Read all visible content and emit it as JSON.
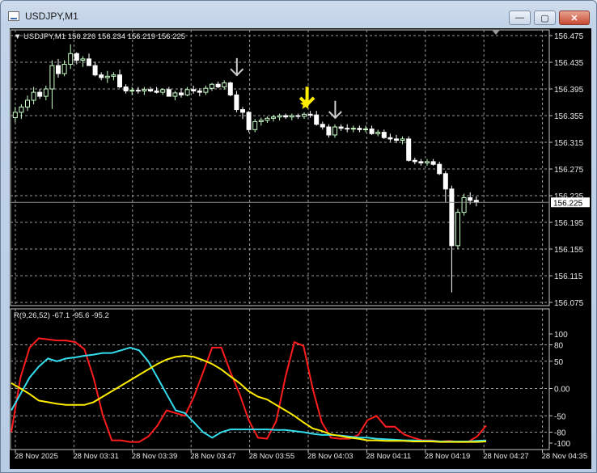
{
  "window": {
    "title": "USDJPY,M1",
    "buttons": {
      "minimize": "—",
      "maximize": "▢",
      "close": "✕"
    }
  },
  "main_panel": {
    "info": "▼ USDJPY,M1  156.226 156.234 156.219 156.225",
    "price_ticks": [
      "156.475",
      "156.435",
      "156.395",
      "156.355",
      "156.315",
      "156.275",
      "156.235",
      "156.195",
      "156.155",
      "156.115",
      "156.075"
    ],
    "current_price": "156.225"
  },
  "indicator_panel": {
    "info": "R(9,26,52) -67.1 -95.6 -95.2",
    "ticks": [
      "100",
      "80",
      "50",
      "0.00",
      "-50",
      "-80",
      "-100"
    ]
  },
  "time_axis": [
    "28 Nov 2025",
    "28 Nov 03:31",
    "28 Nov 03:39",
    "28 Nov 03:47",
    "28 Nov 03:55",
    "28 Nov 04:03",
    "28 Nov 04:11",
    "28 Nov 04:19",
    "28 Nov 04:27",
    "28 Nov 04:35"
  ],
  "colors": {
    "background": "#000000",
    "grid": "#9a9a9a",
    "bull": "#c8ffc8",
    "bear": "#ffffff",
    "line_red": "#ff1c1c",
    "line_cyan": "#33ddee",
    "line_yellow": "#ffee00",
    "arrow_gray": "#cfcfcf",
    "arrow_yellow": "#ffee00"
  },
  "chart_data": [
    {
      "type": "candlestick",
      "symbol": "USDJPY",
      "timeframe": "M1",
      "ylim": [
        156.075,
        156.475
      ],
      "candles": [
        [
          156.352,
          156.368,
          156.345,
          156.36
        ],
        [
          156.36,
          156.372,
          156.35,
          156.368
        ],
        [
          156.368,
          156.385,
          156.362,
          156.378
        ],
        [
          156.378,
          156.398,
          156.372,
          156.39
        ],
        [
          156.39,
          156.395,
          156.38,
          156.384
        ],
        [
          156.384,
          156.4,
          156.378,
          156.395
        ],
        [
          156.395,
          156.438,
          156.365,
          156.43
        ],
        [
          156.43,
          156.44,
          156.412,
          156.418
        ],
        [
          156.418,
          156.438,
          156.414,
          156.432
        ],
        [
          156.432,
          156.462,
          156.425,
          156.448
        ],
        [
          156.448,
          156.45,
          156.432,
          156.438
        ],
        [
          156.438,
          156.444,
          156.428,
          156.44
        ],
        [
          156.44,
          156.448,
          156.432,
          156.43
        ],
        [
          156.43,
          156.436,
          156.414,
          156.416
        ],
        [
          156.416,
          156.42,
          156.408,
          156.412
        ],
        [
          156.412,
          156.422,
          156.404,
          156.414
        ],
        [
          156.414,
          156.42,
          156.408,
          156.416
        ],
        [
          156.416,
          156.424,
          156.396,
          156.398
        ],
        [
          156.398,
          156.402,
          156.388,
          156.392
        ],
        [
          156.392,
          156.398,
          156.386,
          156.393
        ],
        [
          156.393,
          156.398,
          156.388,
          156.392
        ],
        [
          156.392,
          156.398,
          156.386,
          156.394
        ],
        [
          156.394,
          156.398,
          156.39,
          156.392
        ],
        [
          156.392,
          156.398,
          156.388,
          156.39
        ],
        [
          156.39,
          156.396,
          156.386,
          156.394
        ],
        [
          156.394,
          156.398,
          156.386,
          156.384
        ],
        [
          156.384,
          156.392,
          156.378,
          156.389
        ],
        [
          156.389,
          156.396,
          156.382,
          156.386
        ],
        [
          156.386,
          156.398,
          156.384,
          156.394
        ],
        [
          156.394,
          156.4,
          156.388,
          156.392
        ],
        [
          156.392,
          156.396,
          156.384,
          156.39
        ],
        [
          156.39,
          156.4,
          156.386,
          156.396
        ],
        [
          156.396,
          156.404,
          156.392,
          156.402
        ],
        [
          156.402,
          156.406,
          156.396,
          156.398
        ],
        [
          156.398,
          156.408,
          156.394,
          156.404
        ],
        [
          156.404,
          156.406,
          156.384,
          156.386
        ],
        [
          156.386,
          156.392,
          156.36,
          156.364
        ],
        [
          156.364,
          156.368,
          156.35,
          156.36
        ],
        [
          156.36,
          156.362,
          156.33,
          156.334
        ],
        [
          156.334,
          156.35,
          156.33,
          156.346
        ],
        [
          156.346,
          156.352,
          156.34,
          156.348
        ],
        [
          156.348,
          156.354,
          156.344,
          156.351
        ],
        [
          156.351,
          156.356,
          156.346,
          156.353
        ],
        [
          156.353,
          156.358,
          156.348,
          156.355
        ],
        [
          156.355,
          156.358,
          156.35,
          156.353
        ],
        [
          156.353,
          156.358,
          156.348,
          156.355
        ],
        [
          156.355,
          156.358,
          156.35,
          156.354
        ],
        [
          156.354,
          156.36,
          156.35,
          156.357
        ],
        [
          156.357,
          156.362,
          156.352,
          156.356
        ],
        [
          156.356,
          156.362,
          156.34,
          156.342
        ],
        [
          156.342,
          156.346,
          156.334,
          156.338
        ],
        [
          156.338,
          156.342,
          156.322,
          156.326
        ],
        [
          156.326,
          156.342,
          156.322,
          156.338
        ],
        [
          156.338,
          156.342,
          156.332,
          156.336
        ],
        [
          156.336,
          156.342,
          156.33,
          156.335
        ],
        [
          156.335,
          156.34,
          156.33,
          156.336
        ],
        [
          156.336,
          156.34,
          156.33,
          156.334
        ],
        [
          156.334,
          156.34,
          156.33,
          156.335
        ],
        [
          156.335,
          156.34,
          156.326,
          156.328
        ],
        [
          156.328,
          156.334,
          156.324,
          156.33
        ],
        [
          156.33,
          156.334,
          156.32,
          156.322
        ],
        [
          156.322,
          156.328,
          156.316,
          156.32
        ],
        [
          156.32,
          156.326,
          156.314,
          156.318
        ],
        [
          156.318,
          156.324,
          156.312,
          156.32
        ],
        [
          156.32,
          156.324,
          156.286,
          156.288
        ],
        [
          156.288,
          156.292,
          156.282,
          156.286
        ],
        [
          156.286,
          156.29,
          156.28,
          156.284
        ],
        [
          156.284,
          156.29,
          156.28,
          156.286
        ],
        [
          156.286,
          156.29,
          156.28,
          156.282
        ],
        [
          156.282,
          156.286,
          156.266,
          156.268
        ],
        [
          156.268,
          156.272,
          156.225,
          156.245
        ],
        [
          156.245,
          156.25,
          156.09,
          156.16
        ],
        [
          156.16,
          156.215,
          156.155,
          156.21
        ],
        [
          156.21,
          156.238,
          156.205,
          156.232
        ],
        [
          156.232,
          156.24,
          156.222,
          156.228
        ],
        [
          156.228,
          156.234,
          156.219,
          156.225
        ]
      ],
      "signals": [
        {
          "type": "sell-arrow",
          "color": "gray",
          "candle": 35
        },
        {
          "type": "sell-arrow",
          "color": "yellow",
          "candle": 48
        },
        {
          "type": "star",
          "color": "yellow",
          "candle": 48
        },
        {
          "type": "sell-arrow",
          "color": "gray",
          "candle": 51
        }
      ]
    },
    {
      "type": "line",
      "name": "R(9,26,52)",
      "ylim": [
        -100,
        100
      ],
      "series": [
        {
          "color": "red",
          "values": [
            -80,
            20,
            75,
            92,
            90,
            88,
            88,
            85,
            72,
            20,
            -48,
            -95,
            -95,
            -98,
            -98,
            -88,
            -68,
            -40,
            -45,
            -50,
            -15,
            30,
            75,
            75,
            30,
            -10,
            -58,
            -90,
            -92,
            -60,
            20,
            85,
            78,
            0,
            -62,
            -90,
            -92,
            -92,
            -85,
            -58,
            -50,
            -70,
            -70,
            -84,
            -90,
            -95,
            -95,
            -97,
            -96,
            -98,
            -98,
            -88,
            -68
          ]
        },
        {
          "color": "cyan",
          "values": [
            -40,
            -10,
            20,
            40,
            55,
            50,
            55,
            57,
            60,
            62,
            65,
            65,
            70,
            75,
            70,
            50,
            20,
            -10,
            -40,
            -45,
            -62,
            -80,
            -90,
            -80,
            -75,
            -75,
            -75,
            -75,
            -75,
            -76,
            -76,
            -78,
            -80,
            -83,
            -85,
            -85,
            -86,
            -88,
            -90,
            -90,
            -92,
            -93,
            -94,
            -95,
            -95,
            -96,
            -96,
            -97,
            -97,
            -97,
            -97,
            -96,
            -95
          ]
        },
        {
          "color": "yellow",
          "values": [
            10,
            0,
            -10,
            -22,
            -25,
            -28,
            -30,
            -30,
            -30,
            -25,
            -15,
            -5,
            5,
            15,
            25,
            35,
            45,
            53,
            58,
            60,
            58,
            52,
            45,
            35,
            22,
            10,
            -5,
            -15,
            -20,
            -30,
            -40,
            -50,
            -62,
            -73,
            -78,
            -84,
            -87,
            -90,
            -92,
            -95,
            -95,
            -96,
            -96,
            -96,
            -97,
            -97,
            -97,
            -98,
            -98,
            -98,
            -98,
            -98,
            -97
          ]
        }
      ]
    }
  ]
}
